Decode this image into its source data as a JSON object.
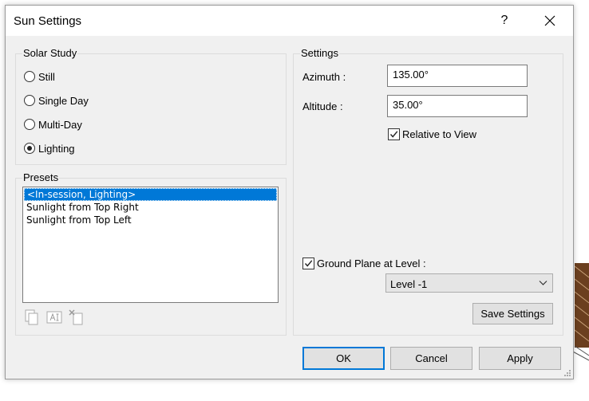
{
  "window": {
    "title": "Sun Settings",
    "help_label": "?"
  },
  "solar_study": {
    "label": "Solar Study",
    "options": [
      {
        "label": "Still",
        "checked": false
      },
      {
        "label": "Single Day",
        "checked": false
      },
      {
        "label": "Multi-Day",
        "checked": false
      },
      {
        "label": "Lighting",
        "checked": true
      }
    ]
  },
  "presets": {
    "label": "Presets",
    "items": [
      {
        "label": "<In-session, Lighting>",
        "selected": true
      },
      {
        "label": "Sunlight from Top Right",
        "selected": false
      },
      {
        "label": "Sunlight from Top Left",
        "selected": false
      }
    ],
    "toolbar_icons": [
      "duplicate-icon",
      "rename-icon",
      "delete-icon"
    ]
  },
  "settings": {
    "label": "Settings",
    "azimuth_label": "Azimuth :",
    "azimuth_value": "135.00°",
    "altitude_label": "Altitude :",
    "altitude_value": "35.00°",
    "relative_to_view_label": "Relative to View",
    "relative_to_view_checked": true,
    "ground_plane_label": "Ground Plane at Level :",
    "ground_plane_checked": true,
    "level_selected": "Level -1",
    "save_settings_label": "Save Settings"
  },
  "footer": {
    "ok_label": "OK",
    "cancel_label": "Cancel",
    "apply_label": "Apply"
  },
  "colors": {
    "selection": "#0078d7",
    "dialog_bg": "#f0f0f0",
    "accent_border": "#0078d7"
  }
}
